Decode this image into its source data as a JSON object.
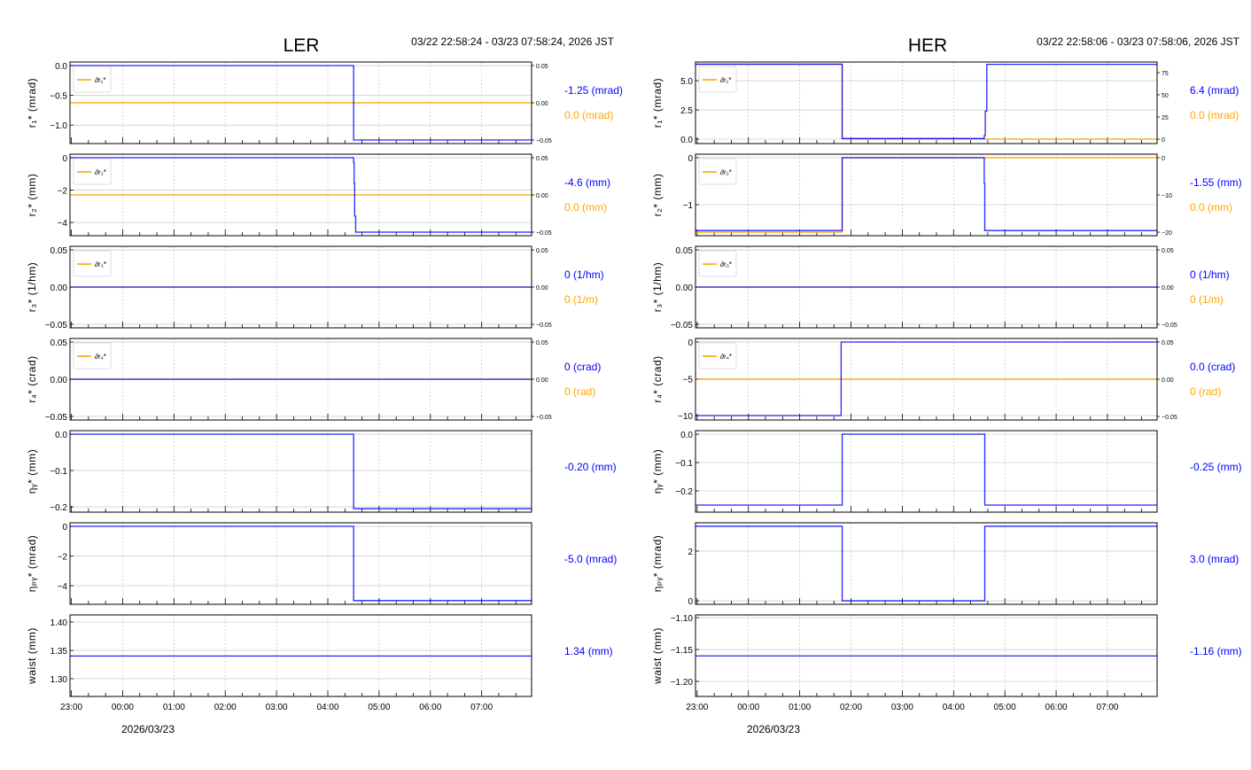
{
  "chart_data": [
    {
      "type": "line",
      "title": "LER",
      "range_label": "03/22 22:58:24 - 03/23 07:58:24, 2026 JST",
      "date_label": "2026/03/23",
      "xticks": [
        {
          "t": 0.027,
          "label": "23:00"
        },
        {
          "t": 1.027,
          "label": "00:00"
        },
        {
          "t": 2.027,
          "label": "01:00"
        },
        {
          "t": 3.027,
          "label": "02:00"
        },
        {
          "t": 4.027,
          "label": "03:00"
        },
        {
          "t": 5.027,
          "label": "04:00"
        },
        {
          "t": 6.027,
          "label": "05:00"
        },
        {
          "t": 7.027,
          "label": "06:00"
        },
        {
          "t": 8.027,
          "label": "07:00"
        }
      ],
      "xlim": [
        0,
        9
      ],
      "colors": {
        "primary": "#0000ff",
        "secondary": "#ffa500"
      },
      "panels": [
        {
          "ylabel": "r₁* (mrad)",
          "ylim": [
            -1.31,
            0.06
          ],
          "yticks": [
            {
              "v": 0,
              "label": "0.0"
            },
            {
              "v": -0.5,
              "label": "−0.5"
            },
            {
              "v": -1,
              "label": "−1.0"
            }
          ],
          "legend": "∂r₁*",
          "rlim": [
            -0.0548,
            0.0548
          ],
          "rticks": [
            {
              "v": 0.05,
              "label": "0.05"
            },
            {
              "v": 0,
              "label": "0.00"
            },
            {
              "v": -0.05,
              "label": "−0.05"
            }
          ],
          "primary": [
            [
              0,
              0
            ],
            [
              5.53,
              -1.25
            ],
            [
              9,
              -1.25
            ]
          ],
          "secondary": [
            [
              0,
              0
            ],
            [
              9,
              0
            ]
          ],
          "value_primary": "-1.25 (mrad)",
          "value_secondary": "0.0 (mrad)"
        },
        {
          "ylabel": "r₂* (mm)",
          "ylim": [
            -4.82,
            0.22
          ],
          "yticks": [
            {
              "v": 0,
              "label": "0"
            },
            {
              "v": -2,
              "label": "−2"
            },
            {
              "v": -4,
              "label": "−4"
            }
          ],
          "legend": "∂r₂*",
          "rlim": [
            -0.0548,
            0.0548
          ],
          "rticks": [
            {
              "v": 0.05,
              "label": "0.05"
            },
            {
              "v": 0,
              "label": "0.00"
            },
            {
              "v": -0.05,
              "label": "−0.05"
            }
          ],
          "primary": [
            [
              0,
              0
            ],
            [
              5.53,
              -0.3
            ],
            [
              5.54,
              -1.6
            ],
            [
              5.55,
              -3.6
            ],
            [
              5.57,
              -4.6
            ],
            [
              9,
              -4.6
            ]
          ],
          "secondary": [
            [
              0,
              0
            ],
            [
              9,
              0
            ]
          ],
          "value_primary": "-4.6 (mm)",
          "value_secondary": "0.0 (mm)"
        },
        {
          "ylabel": "r₃* (1/hm)",
          "ylim": [
            -0.0548,
            0.0548
          ],
          "yticks": [
            {
              "v": 0.05,
              "label": "0.05"
            },
            {
              "v": 0,
              "label": "0.00"
            },
            {
              "v": -0.05,
              "label": "−0.05"
            }
          ],
          "legend": "∂r₃*",
          "rlim": [
            -0.0548,
            0.0548
          ],
          "rticks": [
            {
              "v": 0.05,
              "label": "0.05"
            },
            {
              "v": 0,
              "label": "0.00"
            },
            {
              "v": -0.05,
              "label": "−0.05"
            }
          ],
          "primary": [
            [
              0,
              0
            ],
            [
              9,
              0
            ]
          ],
          "secondary": [
            [
              0,
              0
            ],
            [
              9,
              0
            ]
          ],
          "value_primary": "0 (1/hm)",
          "value_secondary": "0 (1/m)"
        },
        {
          "ylabel": "r₄* (crad)",
          "ylim": [
            -0.0548,
            0.0548
          ],
          "yticks": [
            {
              "v": 0.05,
              "label": "0.05"
            },
            {
              "v": 0,
              "label": "0.00"
            },
            {
              "v": -0.05,
              "label": "−0.05"
            }
          ],
          "legend": "∂r₄*",
          "rlim": [
            -0.0548,
            0.0548
          ],
          "rticks": [
            {
              "v": 0.05,
              "label": "0.05"
            },
            {
              "v": 0,
              "label": "0.00"
            },
            {
              "v": -0.05,
              "label": "−0.05"
            }
          ],
          "primary": [
            [
              0,
              0
            ],
            [
              9,
              0
            ]
          ],
          "secondary": [
            [
              0,
              0
            ],
            [
              9,
              0
            ]
          ],
          "value_primary": "0 (crad)",
          "value_secondary": "0 (rad)"
        },
        {
          "ylabel": "ηᵧ* (mm)",
          "ylim": [
            -0.2146,
            0.0098
          ],
          "yticks": [
            {
              "v": 0,
              "label": "0.0"
            },
            {
              "v": -0.1,
              "label": "−0.1"
            },
            {
              "v": -0.2,
              "label": "−0.2"
            }
          ],
          "primary": [
            [
              0,
              0
            ],
            [
              5.53,
              -0.205
            ],
            [
              9,
              -0.205
            ]
          ],
          "value_primary": "-0.20 (mm)"
        },
        {
          "ylabel": "ηₚᵧ* (mrad)",
          "ylim": [
            -5.25,
            0.24
          ],
          "yticks": [
            {
              "v": 0,
              "label": "0"
            },
            {
              "v": -2,
              "label": "−2"
            },
            {
              "v": -4,
              "label": "−4"
            }
          ],
          "primary": [
            [
              0,
              0
            ],
            [
              5.53,
              -5
            ],
            [
              9,
              -5
            ]
          ],
          "value_primary": "-5.0 (mrad)"
        },
        {
          "ylabel": "waist (mm)",
          "ylim": [
            1.2687,
            1.4125
          ],
          "yticks": [
            {
              "v": 1.4,
              "label": "1.40"
            },
            {
              "v": 1.35,
              "label": "1.35"
            },
            {
              "v": 1.3,
              "label": "1.30"
            }
          ],
          "primary": [
            [
              0,
              1.34
            ],
            [
              9,
              1.34
            ]
          ],
          "value_primary": "1.34 (mm)"
        }
      ]
    },
    {
      "type": "line",
      "title": "HER",
      "range_label": "03/22 22:58:06 - 03/23 07:58:06, 2026 JST",
      "date_label": "2026/03/23",
      "xticks": [
        {
          "t": 0.032,
          "label": "23:00"
        },
        {
          "t": 1.032,
          "label": "00:00"
        },
        {
          "t": 2.032,
          "label": "01:00"
        },
        {
          "t": 3.032,
          "label": "02:00"
        },
        {
          "t": 4.032,
          "label": "03:00"
        },
        {
          "t": 5.032,
          "label": "04:00"
        },
        {
          "t": 6.032,
          "label": "05:00"
        },
        {
          "t": 7.032,
          "label": "06:00"
        },
        {
          "t": 8.032,
          "label": "07:00"
        }
      ],
      "xlim": [
        0,
        9
      ],
      "colors": {
        "primary": "#0000ff",
        "secondary": "#ffa500"
      },
      "panels": [
        {
          "ylabel": "r₁* (mrad)",
          "ylim": [
            -0.38,
            6.6
          ],
          "yticks": [
            {
              "v": 5,
              "label": "5.0"
            },
            {
              "v": 2.5,
              "label": "2.5"
            },
            {
              "v": 0,
              "label": "0.0"
            }
          ],
          "legend": "∂r₁*",
          "rlim": [
            -5,
            87
          ],
          "rticks": [
            {
              "v": 75,
              "label": "75"
            },
            {
              "v": 50,
              "label": "50"
            },
            {
              "v": 25,
              "label": "25"
            },
            {
              "v": 0,
              "label": "0"
            }
          ],
          "primary": [
            [
              0,
              6.4
            ],
            [
              2.86,
              0.05
            ],
            [
              5.63,
              0.3
            ],
            [
              5.65,
              2.4
            ],
            [
              5.68,
              6.4
            ],
            [
              9,
              6.4
            ]
          ],
          "secondary": [
            [
              0,
              85
            ],
            [
              2.86,
              0
            ],
            [
              9,
              0
            ]
          ],
          "value_primary": "6.4 (mrad)",
          "value_secondary": "0.0 (mrad)"
        },
        {
          "ylabel": "r₂* (mm)",
          "ylim": [
            -1.66,
            0.075
          ],
          "yticks": [
            {
              "v": 0,
              "label": "0"
            },
            {
              "v": -1,
              "label": "−1"
            }
          ],
          "legend": "∂r₂*",
          "rlim": [
            -20.95,
            0.95
          ],
          "rticks": [
            {
              "v": 0,
              "label": "0"
            },
            {
              "v": -10,
              "label": "−10"
            },
            {
              "v": -20,
              "label": "−20"
            }
          ],
          "primary": [
            [
              0,
              -1.55
            ],
            [
              2.86,
              0
            ],
            [
              5.63,
              -0.55
            ],
            [
              5.64,
              -1.55
            ],
            [
              9,
              -1.55
            ]
          ],
          "secondary": [
            [
              0,
              -20
            ],
            [
              2.86,
              0
            ],
            [
              9,
              0
            ]
          ],
          "value_primary": "-1.55 (mm)",
          "value_secondary": "0.0 (mm)"
        },
        {
          "ylabel": "r₃* (1/hm)",
          "ylim": [
            -0.0548,
            0.0548
          ],
          "yticks": [
            {
              "v": 0.05,
              "label": "0.05"
            },
            {
              "v": 0,
              "label": "0.00"
            },
            {
              "v": -0.05,
              "label": "−0.05"
            }
          ],
          "legend": "∂r₃*",
          "rlim": [
            -0.0548,
            0.0548
          ],
          "rticks": [
            {
              "v": 0.05,
              "label": "0.05"
            },
            {
              "v": 0,
              "label": "0.00"
            },
            {
              "v": -0.05,
              "label": "−0.05"
            }
          ],
          "primary": [
            [
              0,
              0
            ],
            [
              9,
              0
            ]
          ],
          "secondary": [
            [
              0,
              0
            ],
            [
              9,
              0
            ]
          ],
          "value_primary": "0 (1/hm)",
          "value_secondary": "0 (1/m)"
        },
        {
          "ylabel": "r₄* (crad)",
          "ylim": [
            -10.6,
            0.48
          ],
          "yticks": [
            {
              "v": 0,
              "label": "0"
            },
            {
              "v": -5,
              "label": "−5"
            },
            {
              "v": -10,
              "label": "−10"
            }
          ],
          "legend": "∂r₄*",
          "rlim": [
            -0.0548,
            0.0548
          ],
          "rticks": [
            {
              "v": 0.05,
              "label": "0.05"
            },
            {
              "v": 0,
              "label": "0.00"
            },
            {
              "v": -0.05,
              "label": "−0.05"
            }
          ],
          "primary": [
            [
              0,
              -10
            ],
            [
              2.84,
              0
            ],
            [
              9,
              0
            ]
          ],
          "secondary": [
            [
              0,
              0
            ],
            [
              9,
              0
            ]
          ],
          "value_primary": "0.0 (crad)",
          "value_secondary": "0 (rad)"
        },
        {
          "ylabel": "ηᵧ* (mm)",
          "ylim": [
            -0.275,
            0.0125
          ],
          "yticks": [
            {
              "v": 0,
              "label": "0.0"
            },
            {
              "v": -0.1,
              "label": "−0.1"
            },
            {
              "v": -0.2,
              "label": "−0.2"
            }
          ],
          "primary": [
            [
              0,
              -0.25
            ],
            [
              2.86,
              0
            ],
            [
              5.64,
              -0.25
            ],
            [
              9,
              -0.25
            ]
          ],
          "value_primary": "-0.25 (mm)"
        },
        {
          "ylabel": "ηₚᵧ* (mrad)",
          "ylim": [
            -0.14,
            3.14
          ],
          "yticks": [
            {
              "v": 2,
              "label": "2"
            },
            {
              "v": 0,
              "label": "0"
            }
          ],
          "primary": [
            [
              0,
              3
            ],
            [
              2.86,
              0
            ],
            [
              5.64,
              3
            ],
            [
              9,
              3
            ]
          ],
          "value_primary": "3.0 (mrad)"
        },
        {
          "ylabel": "waist (mm)",
          "ylim": [
            -1.2236,
            -1.0958
          ],
          "yticks": [
            {
              "v": -1.1,
              "label": "−1.10"
            },
            {
              "v": -1.15,
              "label": "−1.15"
            },
            {
              "v": -1.2,
              "label": "−1.20"
            }
          ],
          "primary": [
            [
              0,
              -1.16
            ],
            [
              9,
              -1.16
            ]
          ],
          "value_primary": "-1.16 (mm)"
        }
      ]
    }
  ]
}
